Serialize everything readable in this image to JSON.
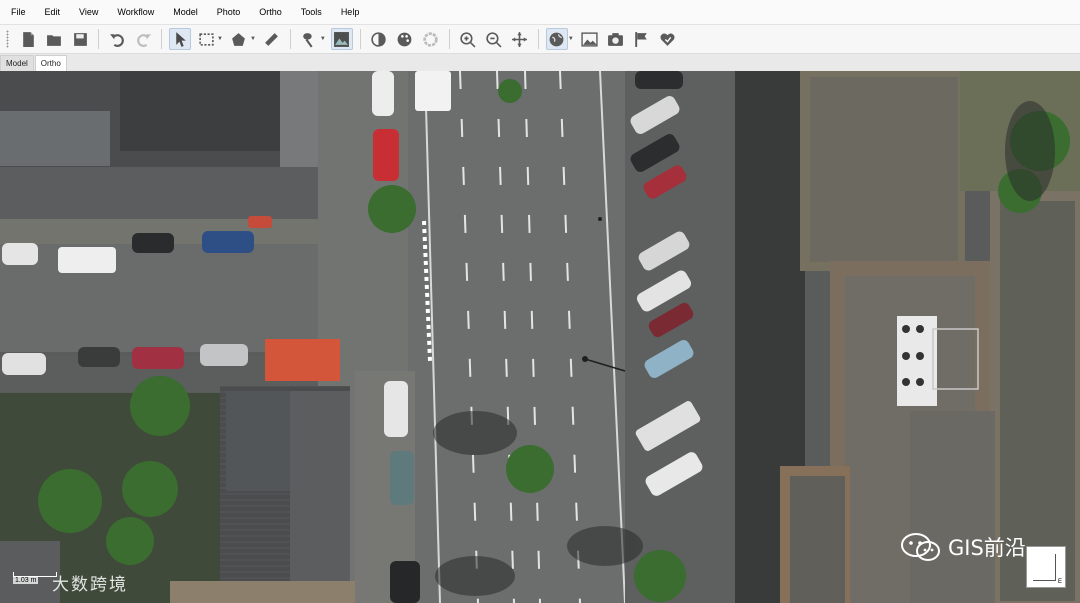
{
  "menu": [
    "File",
    "Edit",
    "View",
    "Workflow",
    "Model",
    "Photo",
    "Ortho",
    "Tools",
    "Help"
  ],
  "toolbar": {
    "icons": [
      "new-document-icon",
      "open-folder-icon",
      "save-icon",
      "undo-icon",
      "redo-icon",
      "select-pointer-icon",
      "rectangle-selection-icon",
      "polygon-selection-icon",
      "ruler-icon",
      "draw-polygon-icon",
      "orthomosaic-view-icon",
      "contrast-icon",
      "palette-icon",
      "seamline-icon",
      "zoom-in-icon",
      "zoom-out-icon",
      "move-icon",
      "globe-icon",
      "image-icon",
      "camera-icon",
      "flag-icon",
      "shape-heart-icon"
    ]
  },
  "tabs": [
    {
      "label": "Model"
    },
    {
      "label": "Ortho"
    }
  ],
  "scale": {
    "label": "1.03 m"
  },
  "watermark": {
    "left": "大数跨境",
    "right": "GIS前沿"
  },
  "navigator": {
    "label": "E"
  },
  "colors": {
    "road": "#6b6e6d",
    "roof_dark": "#3a3c3d",
    "roof_tan": "#8c7f6c",
    "accent_red": "#d4563a"
  }
}
